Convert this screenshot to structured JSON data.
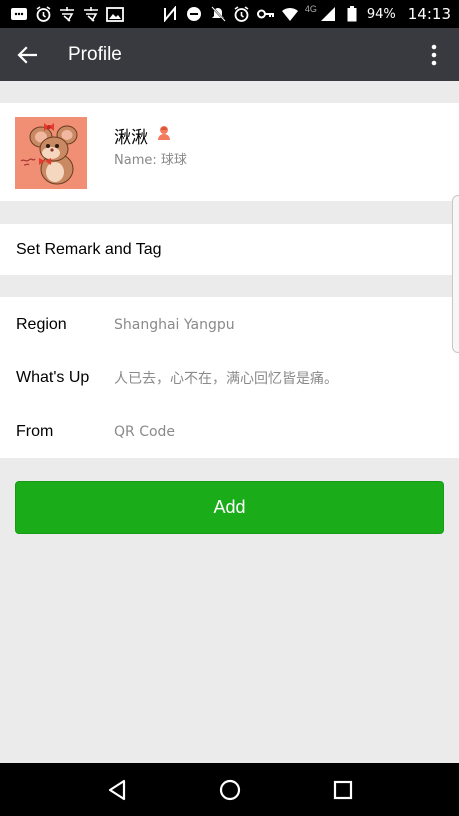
{
  "status_bar": {
    "left_icons": [
      "message-icon",
      "alarm-icon",
      "app-icon",
      "app-icon",
      "image-icon"
    ],
    "right_icons": [
      "nfc-icon",
      "dnd-icon",
      "mute-icon",
      "alarm-icon",
      "key-icon",
      "wifi-icon",
      "signal-icon",
      "battery-icon"
    ],
    "network": "4G",
    "battery": "94%",
    "time": "14:13"
  },
  "header": {
    "title": "Profile"
  },
  "profile": {
    "nickname": "湫湫",
    "name_prefix": "Name: ",
    "name_value": "球球",
    "avatar_bg": "#f08f74"
  },
  "remark": {
    "label": "Set Remark and Tag"
  },
  "info": [
    {
      "key": "Region",
      "value": "Shanghai  Yangpu"
    },
    {
      "key": "What's Up",
      "value": "人已去，心不在，满心回忆皆是痛。"
    },
    {
      "key": "From",
      "value": "QR Code"
    }
  ],
  "actions": {
    "add_label": "Add"
  },
  "colors": {
    "accent": "#1aad19",
    "header_bg": "#393a3f",
    "page_bg": "#ebebeb",
    "muted_text": "#8a8a8a"
  }
}
